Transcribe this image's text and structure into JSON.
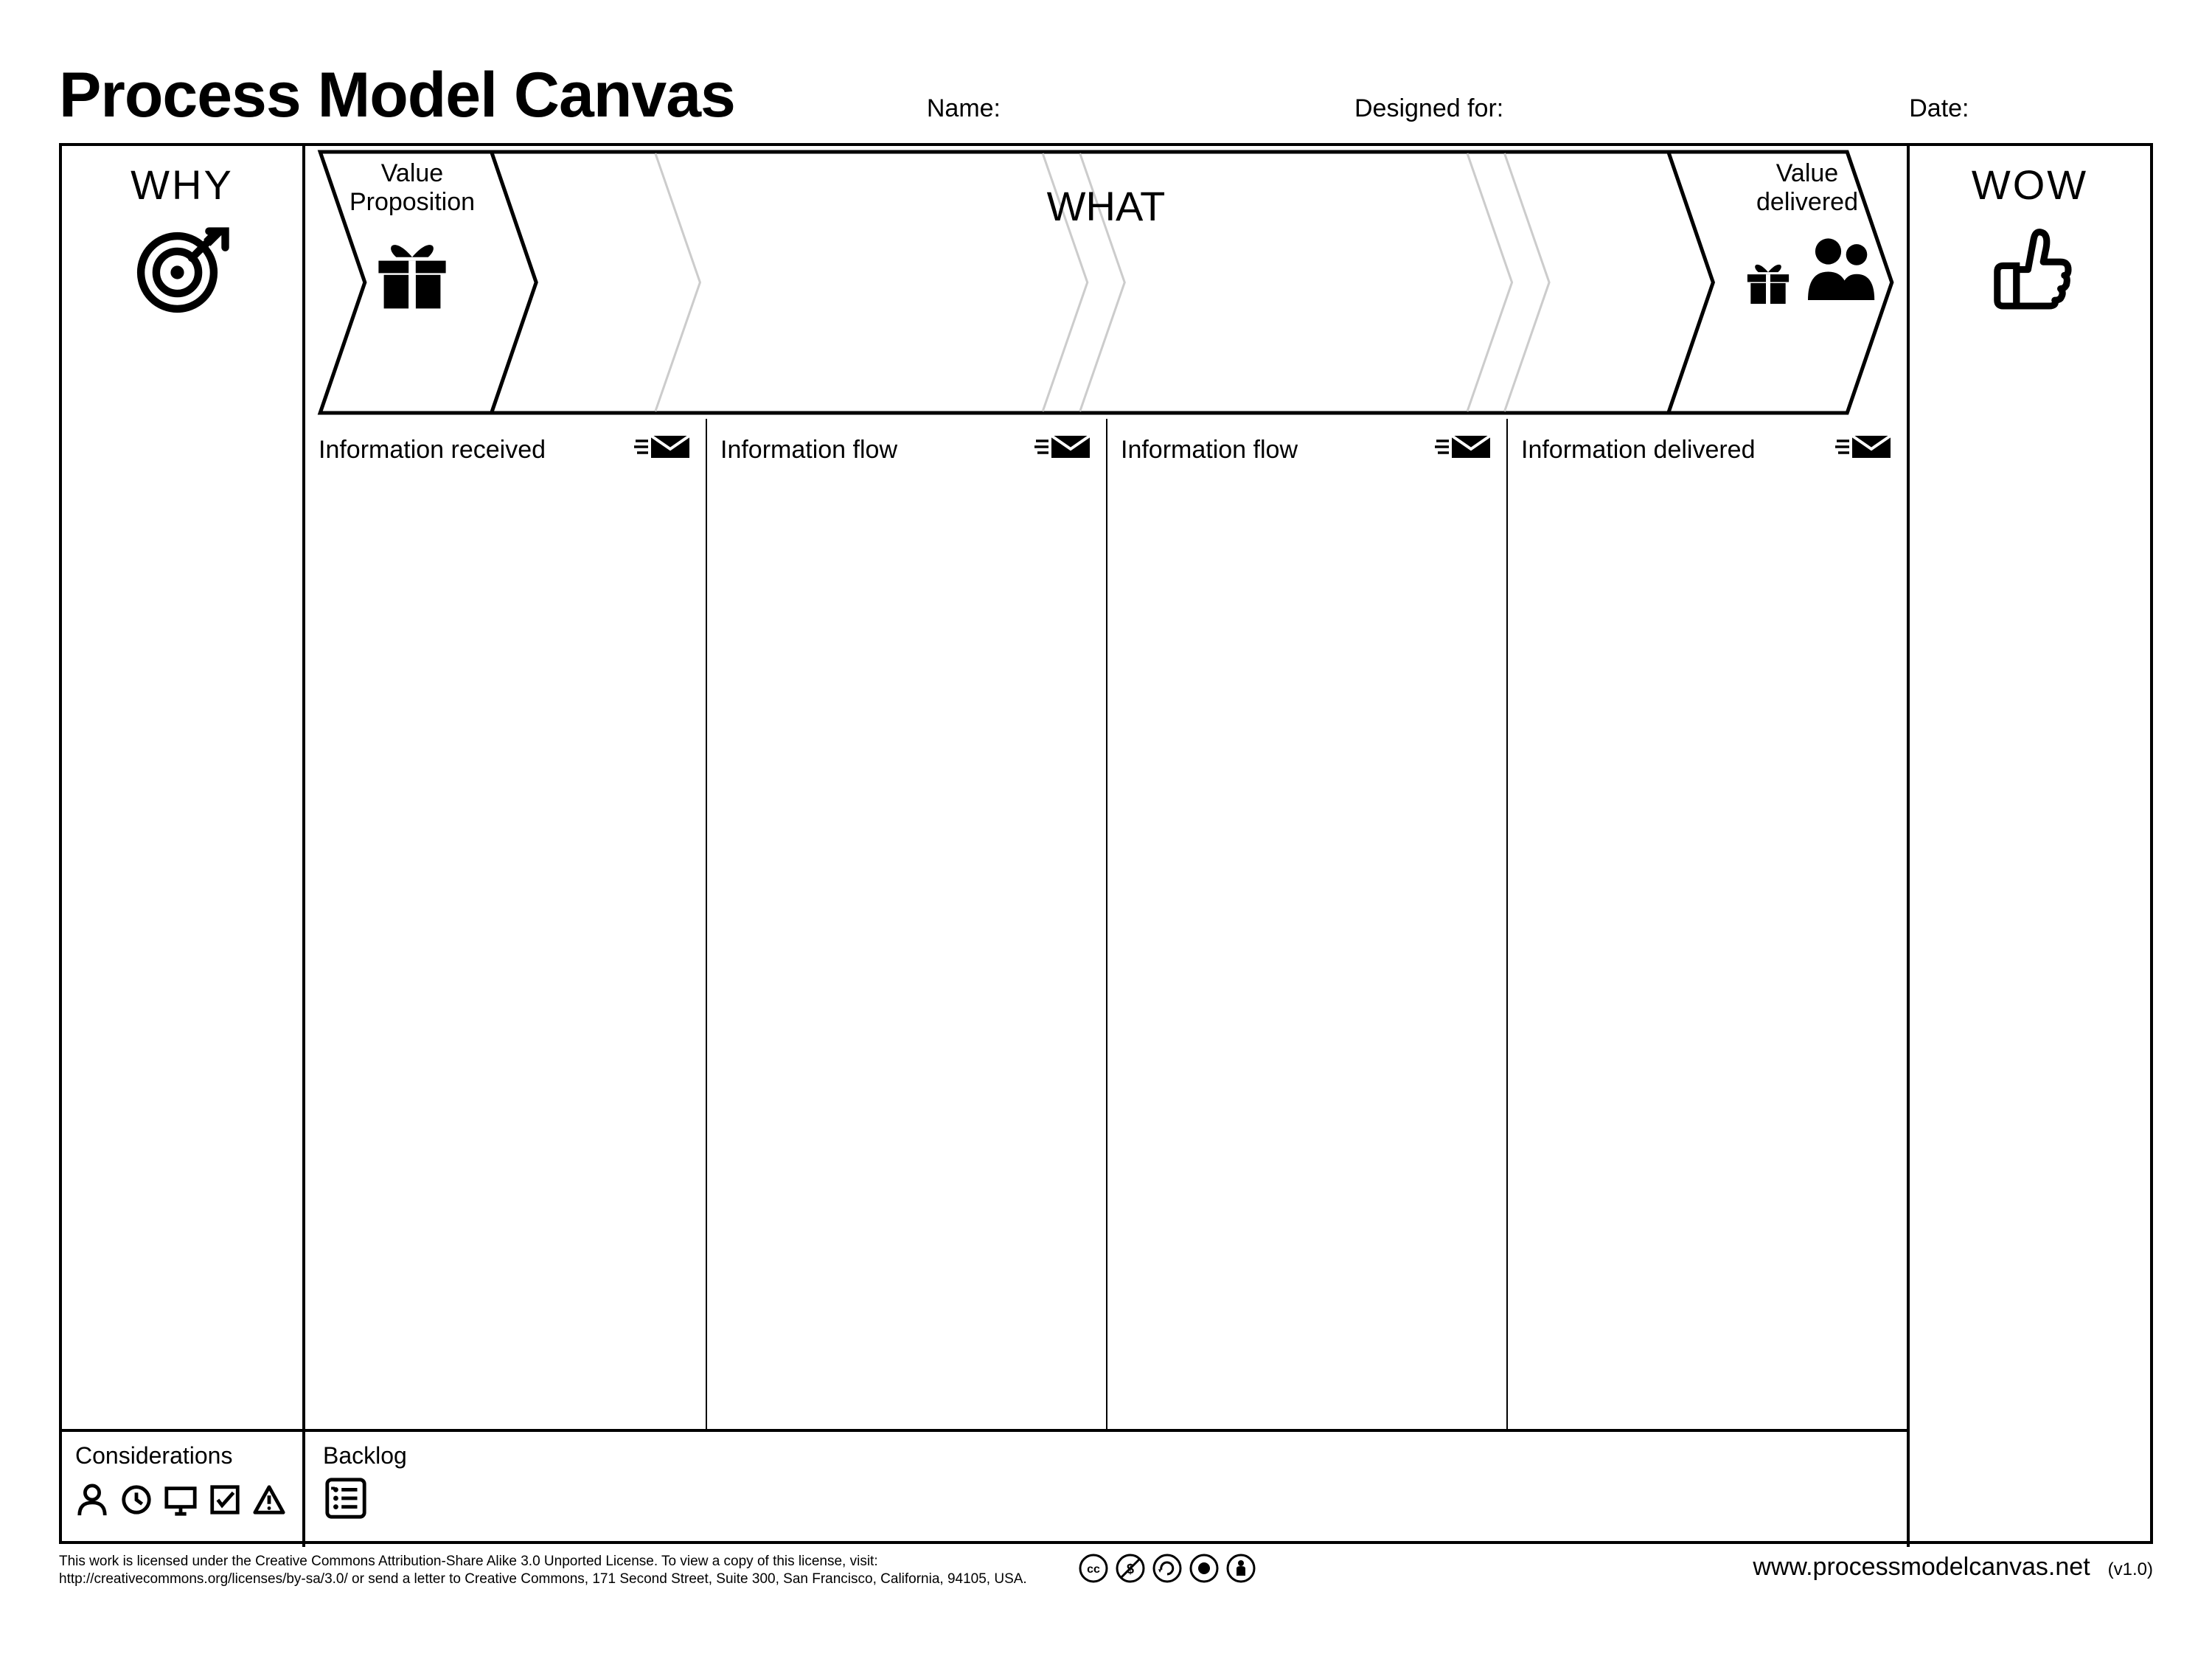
{
  "title": "Process Model Canvas",
  "meta": {
    "name_label": "Name:",
    "designed_for_label": "Designed for:",
    "date_label": "Date:"
  },
  "why": {
    "label": "WHY"
  },
  "wow": {
    "label": "WOW"
  },
  "chevrons": {
    "value_proposition": "Value Proposition",
    "what": "WHAT",
    "value_delivered": "Value delivered"
  },
  "info_columns": [
    {
      "label": "Information received"
    },
    {
      "label": "Information flow"
    },
    {
      "label": "Information flow"
    },
    {
      "label": "Information delivered"
    }
  ],
  "considerations": {
    "label": "Considerations"
  },
  "backlog": {
    "label": "Backlog"
  },
  "footer": {
    "license_line1": "This work is licensed under the Creative Commons Attribution-Share Alike 3.0 Unported License. To view a copy of this license, visit:",
    "license_line2": "http://creativecommons.org/licenses/by-sa/3.0/ or send a letter to Creative Commons, 171 Second Street, Suite 300, San Francisco, California, 94105, USA.",
    "site": "www.processmodelcanvas.net",
    "version": "(v1.0)"
  }
}
